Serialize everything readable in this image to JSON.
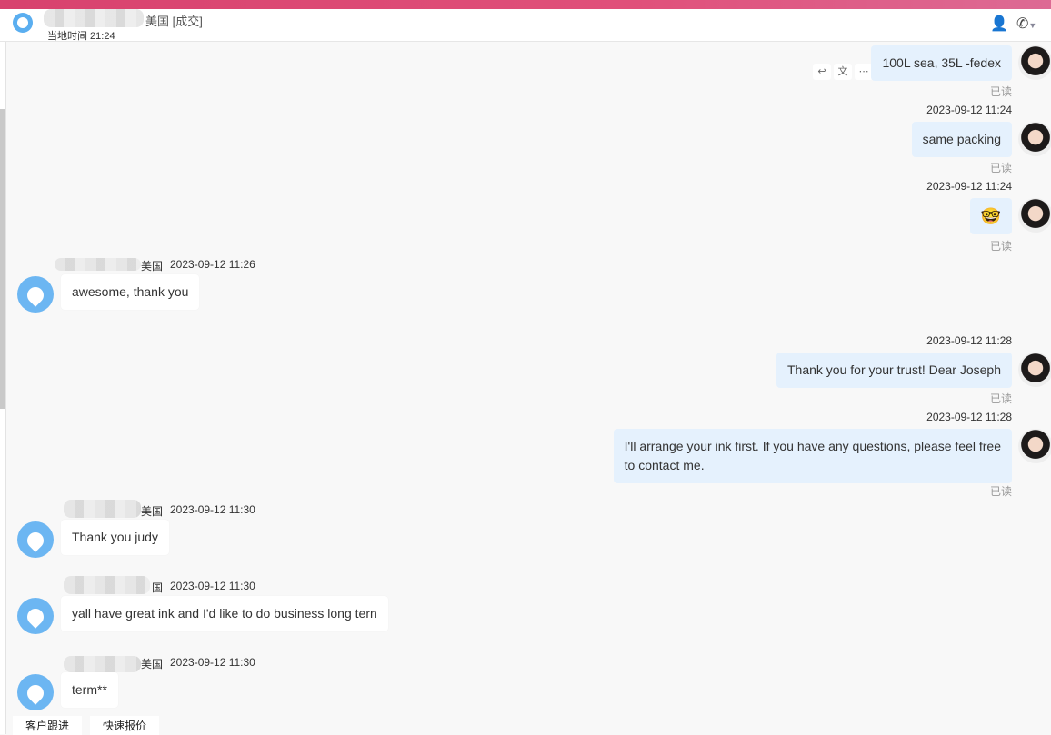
{
  "header": {
    "contact_country": "美国",
    "contact_status": "[成交]",
    "local_time": "当地时间 21:24"
  },
  "messages": [
    {
      "dir": "out",
      "text": "100L sea, 35L -fedex",
      "status": "已读"
    },
    {
      "dir": "out",
      "time": "2023-09-12 11:24",
      "text": "same packing",
      "status": "已读"
    },
    {
      "dir": "out",
      "time": "2023-09-12 11:24",
      "text": "🤓",
      "status": "已读"
    },
    {
      "dir": "in",
      "sender": "美国",
      "time": "2023-09-12 11:26",
      "text": "awesome, thank you"
    },
    {
      "dir": "out",
      "time": "2023-09-12 11:28",
      "text": "Thank you for your trust! Dear Joseph",
      "status": "已读"
    },
    {
      "dir": "out",
      "time": "2023-09-12 11:28",
      "text": "I'll arrange your ink first. If you have any questions, please feel free",
      "text2": "to contact me.",
      "status": "已读"
    },
    {
      "dir": "in",
      "sender": "美国",
      "time": "2023-09-12 11:30",
      "text": "Thank you judy"
    },
    {
      "dir": "in",
      "sender": "国",
      "time": "2023-09-12 11:30",
      "text": "yall have great ink and I'd like to do business long tern"
    },
    {
      "dir": "in",
      "sender": "美国",
      "time": "2023-09-12 11:30",
      "text": "term**"
    }
  ],
  "bottom": {
    "follow_up": "客户跟进",
    "quick_quote": "快速报价"
  },
  "icons": {
    "tools": [
      "reply-icon",
      "translate-icon",
      "more-icon"
    ]
  }
}
